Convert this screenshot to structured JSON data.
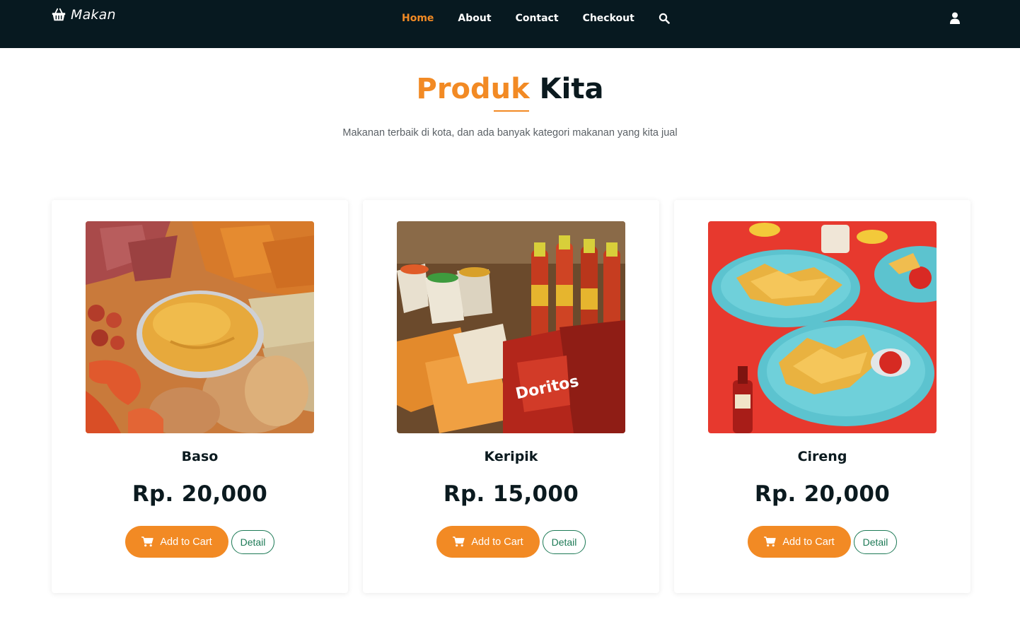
{
  "navbar": {
    "brand": "Makan",
    "brand_icon": "basket-icon",
    "links": [
      {
        "label": "Home",
        "active": true
      },
      {
        "label": "About",
        "active": false
      },
      {
        "label": "Contact",
        "active": false
      },
      {
        "label": "Checkout",
        "active": false
      }
    ],
    "search_icon": "search-icon",
    "user_icon": "user-icon"
  },
  "section": {
    "title_accent": "Produk",
    "title_rest": "Kita",
    "subtitle": "Makanan terbaik di kota, dan ada banyak kategori makanan yang kita jual"
  },
  "products": [
    {
      "name": "Baso",
      "price": "Rp. 20,000",
      "cart_label": "Add to Cart",
      "detail_label": "Detail"
    },
    {
      "name": "Keripik",
      "price": "Rp. 15,000",
      "cart_label": "Add to Cart",
      "detail_label": "Detail"
    },
    {
      "name": "Cireng",
      "price": "Rp. 20,000",
      "cart_label": "Add to Cart",
      "detail_label": "Detail"
    }
  ],
  "colors": {
    "navbar_bg": "#071920",
    "accent": "#f28a24",
    "detail_outline": "#1d7a56",
    "text_dark": "#0b1a1f"
  }
}
